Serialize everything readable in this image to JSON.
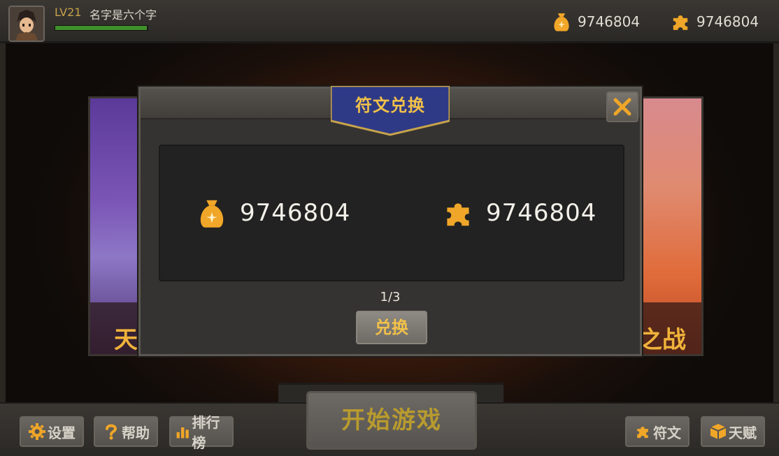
{
  "player": {
    "level": "LV21",
    "name": "名字是六个字",
    "xp_fraction": 0.99
  },
  "topbar": {
    "gold": "9746804",
    "rune": "9746804"
  },
  "cards": {
    "left_label": "天",
    "right_label": "之战"
  },
  "dialog": {
    "title": "符文兑换",
    "gold_value": "9746804",
    "rune_value": "9746804",
    "page": "1/3",
    "exchange_label": "兑换"
  },
  "bottom": {
    "settings_label": "设置",
    "help_label": "帮助",
    "rank_label": "排行榜",
    "start_label": "开始游戏",
    "rune_label": "符文",
    "talent_label": "天赋"
  },
  "colors": {
    "gold_text": "#f2c14a",
    "icon_gold": "#f0a628",
    "xp": "#3f8f2a"
  },
  "icons": [
    "avatar",
    "money-bag-icon",
    "puzzle-icon",
    "close-icon",
    "gear-icon",
    "question-icon",
    "chart-icon",
    "box-icon"
  ]
}
